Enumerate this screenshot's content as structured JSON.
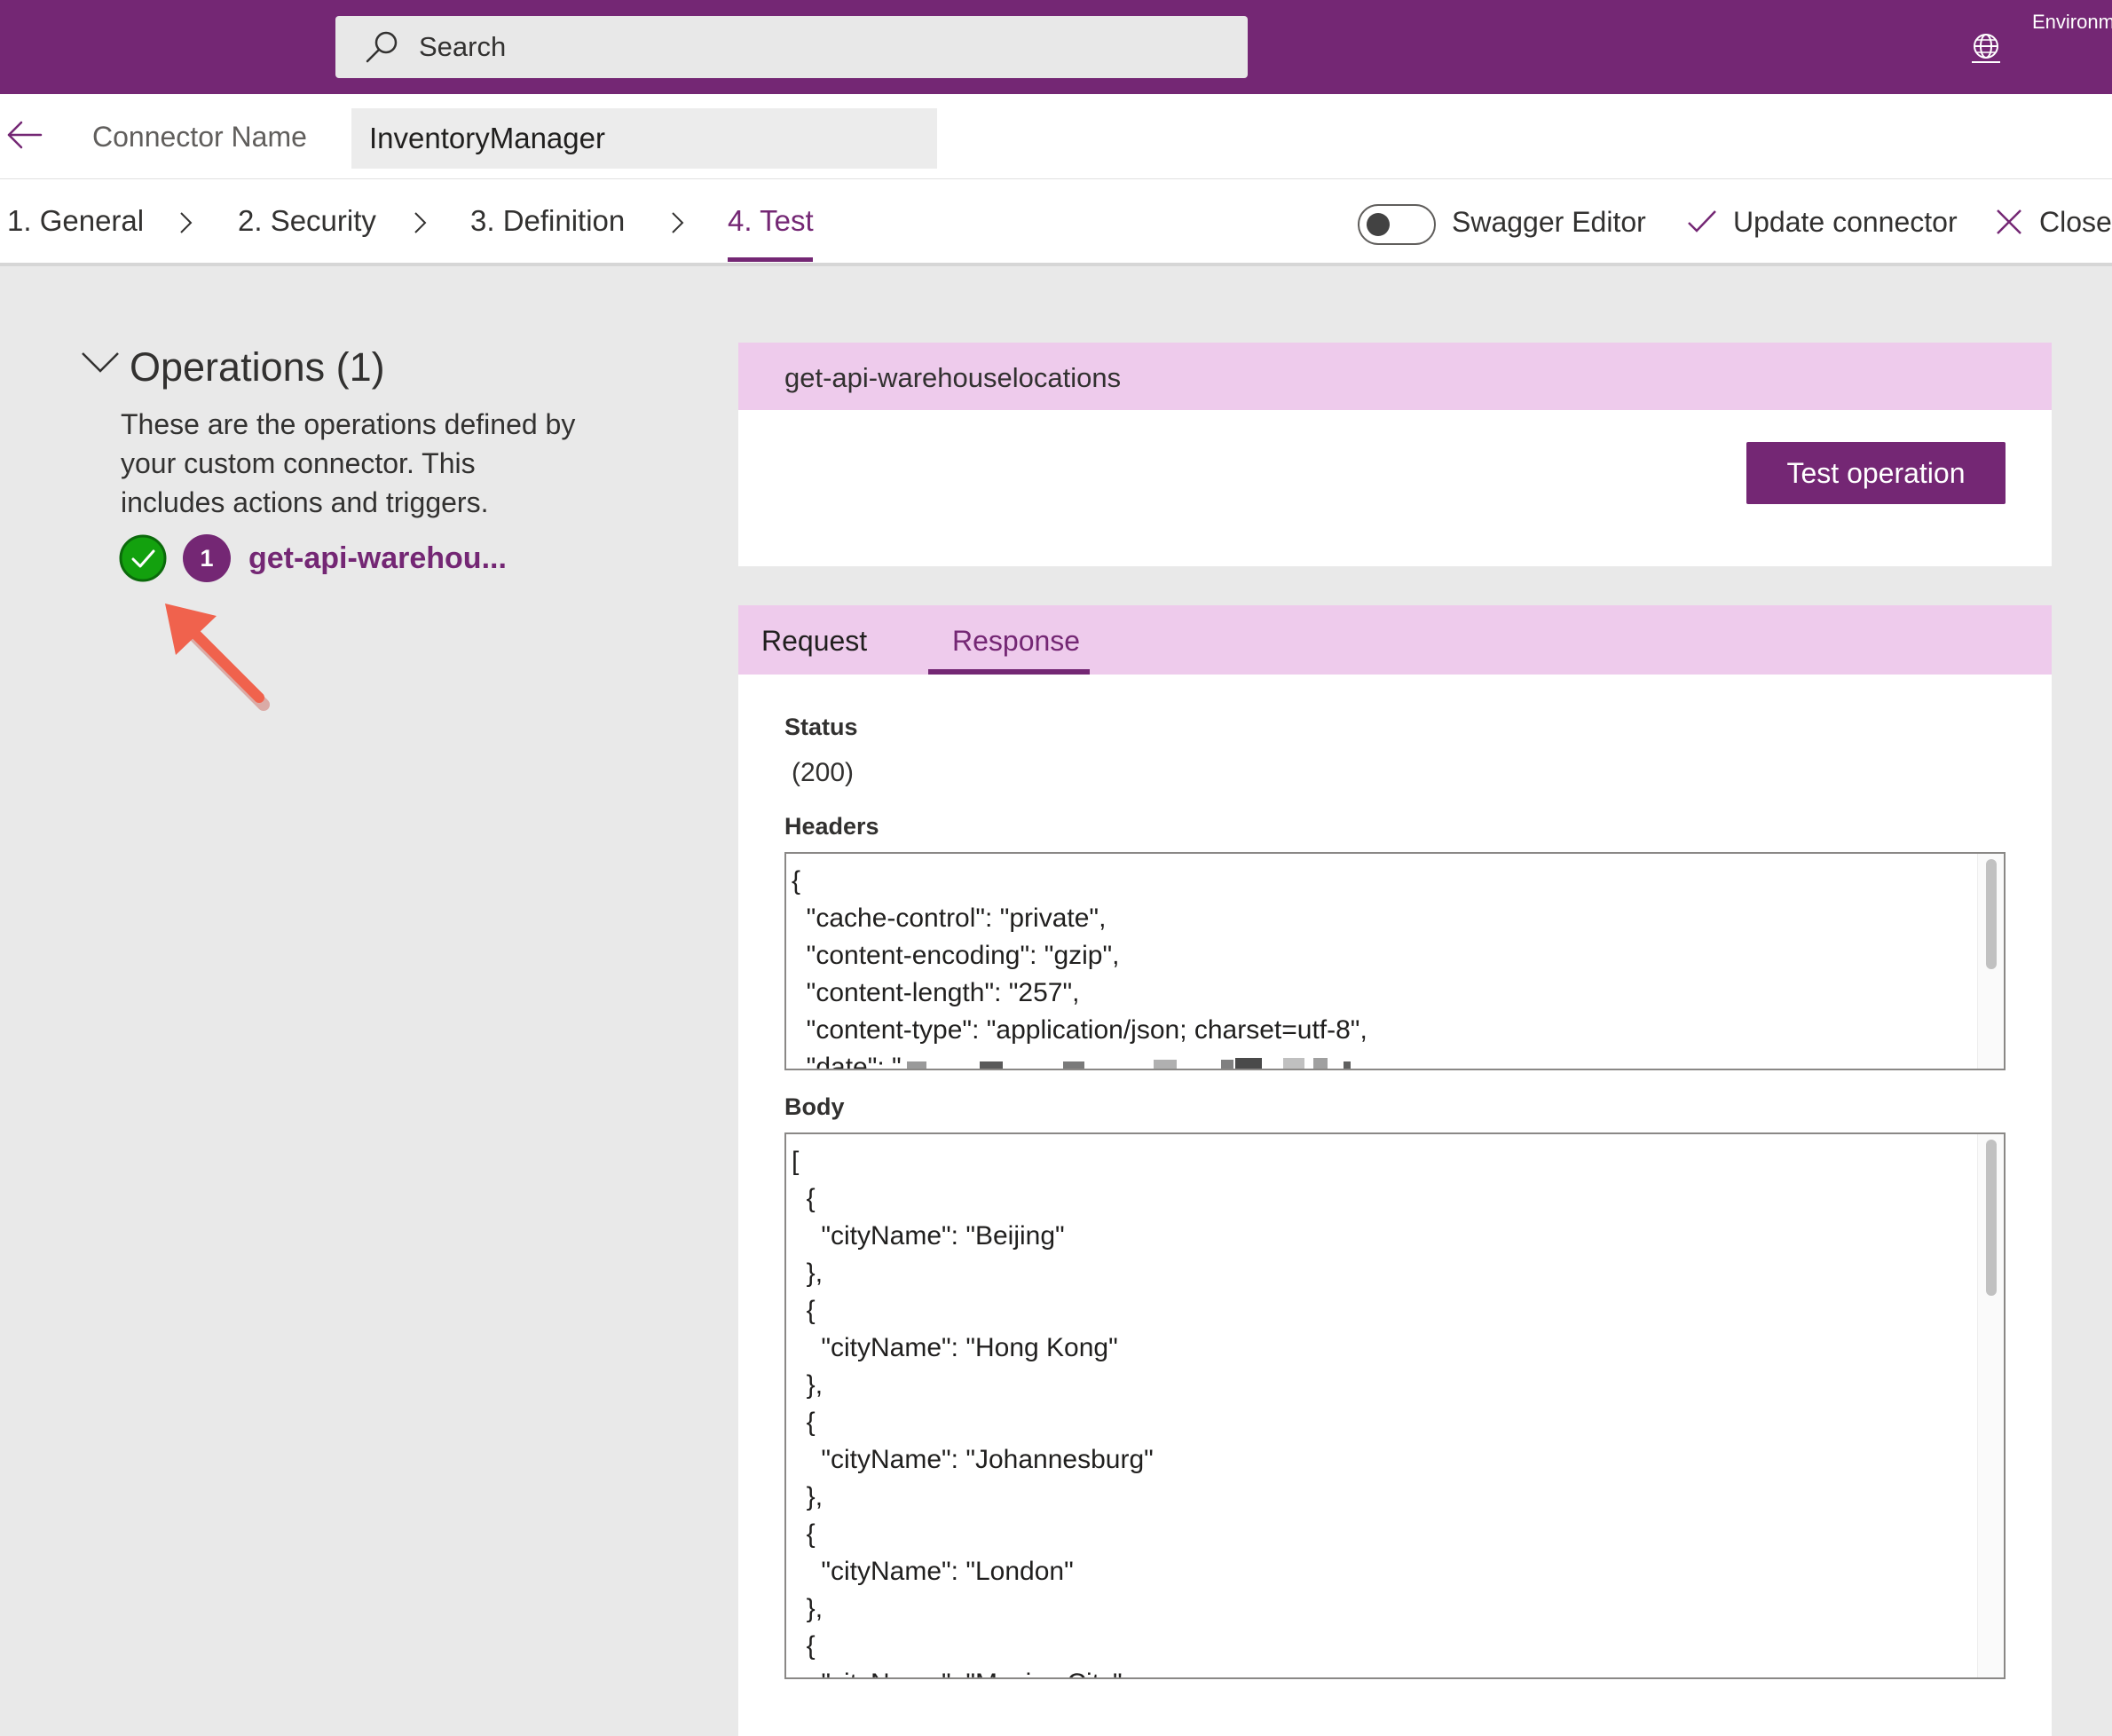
{
  "topbar": {
    "search_placeholder": "Search",
    "environment_label": "Environments",
    "brand_color": "#742774"
  },
  "connector": {
    "name_label": "Connector Name",
    "name_value": "InventoryManager"
  },
  "steps": [
    {
      "label": "1. General"
    },
    {
      "label": "2. Security"
    },
    {
      "label": "3. Definition"
    },
    {
      "label": "4. Test",
      "active": true
    }
  ],
  "toolbar": {
    "swagger_label": "Swagger Editor",
    "update_label": "Update connector",
    "close_label": "Close"
  },
  "operations": {
    "title": "Operations (1)",
    "description": "These are the operations defined by your custom connector. This includes actions and triggers.",
    "items": [
      {
        "number": "1",
        "name": "get-api-warehou..."
      }
    ]
  },
  "operation_panel": {
    "title": "get-api-warehouselocations",
    "test_button": "Test operation"
  },
  "tabs": {
    "request": "Request",
    "response": "Response"
  },
  "response": {
    "status_label": "Status",
    "status_value": "(200)",
    "headers_label": "Headers",
    "headers_text": "{\n  \"cache-control\": \"private\",\n  \"content-encoding\": \"gzip\",\n  \"content-length\": \"257\",\n  \"content-type\": \"application/json; charset=utf-8\",\n  \"date\": \"",
    "body_label": "Body",
    "body_text": "[\n  {\n    \"cityName\": \"Beijing\"\n  },\n  {\n    \"cityName\": \"Hong Kong\"\n  },\n  {\n    \"cityName\": \"Johannesburg\"\n  },\n  {\n    \"cityName\": \"London\"\n  },\n  {\n    \"cityName\": \"Mexico City\""
  }
}
